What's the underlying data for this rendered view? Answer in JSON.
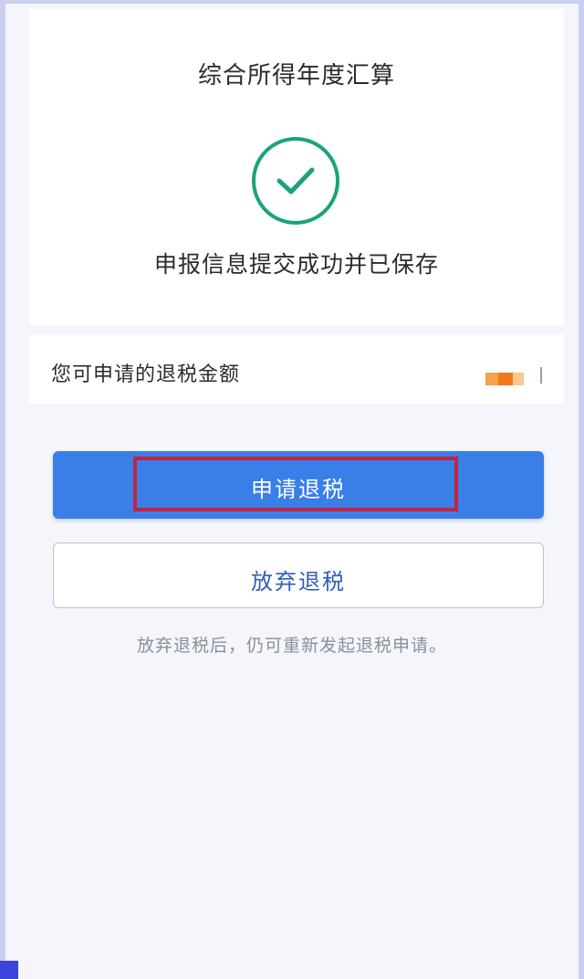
{
  "header": {
    "title": "综合所得年度汇算"
  },
  "status": {
    "icon": "check-circle-icon",
    "message": "申报信息提交成功并已保存",
    "accent_color": "#1aa37a"
  },
  "refund": {
    "label": "您可申请的退税金额",
    "amount_redacted_colors": [
      "#f07b1c",
      "#f5a24a",
      "#f9c98f"
    ]
  },
  "actions": {
    "apply_label": "申请退税",
    "apply_color": "#3a7ee8",
    "highlight_color": "#c2243d",
    "giveup_label": "放弃退税",
    "giveup_color": "#2e5fb8"
  },
  "hint": "放弃退税后，仍可重新发起退税申请。"
}
